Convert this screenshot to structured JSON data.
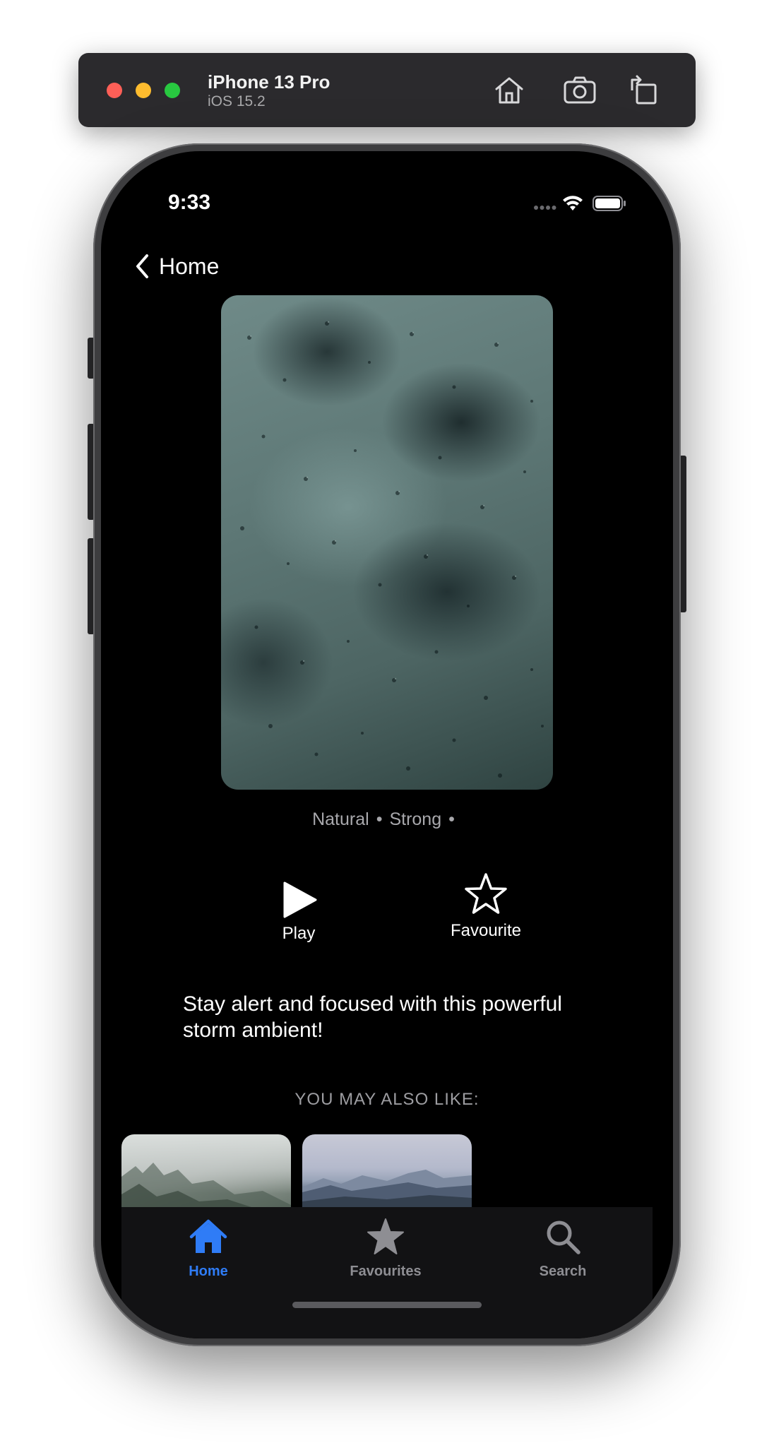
{
  "simulator": {
    "device_name": "iPhone 13 Pro",
    "os_version": "iOS 15.2",
    "buttons": [
      "home-icon",
      "screenshot-icon",
      "rotate-icon"
    ]
  },
  "status_bar": {
    "time": "9:33"
  },
  "nav": {
    "back_label": "Home"
  },
  "hero": {
    "image": "rain-drops-on-window"
  },
  "tags": [
    "Natural",
    "Strong"
  ],
  "actions": {
    "play_label": "Play",
    "favourite_label": "Favourite"
  },
  "description": "Stay alert and focused with this powerful storm ambient!",
  "recommendations": {
    "heading": "YOU MAY ALSO LIKE:",
    "items": [
      "misty-forest-image",
      "snowy-mountains-image"
    ]
  },
  "tab_bar": {
    "items": [
      {
        "label": "Home",
        "icon": "house-icon",
        "active": true
      },
      {
        "label": "Favourites",
        "icon": "star-icon",
        "active": false
      },
      {
        "label": "Search",
        "icon": "magnifier-icon",
        "active": false
      }
    ],
    "accent_color": "#2f7cf6",
    "inactive_color": "#8e8e93"
  }
}
